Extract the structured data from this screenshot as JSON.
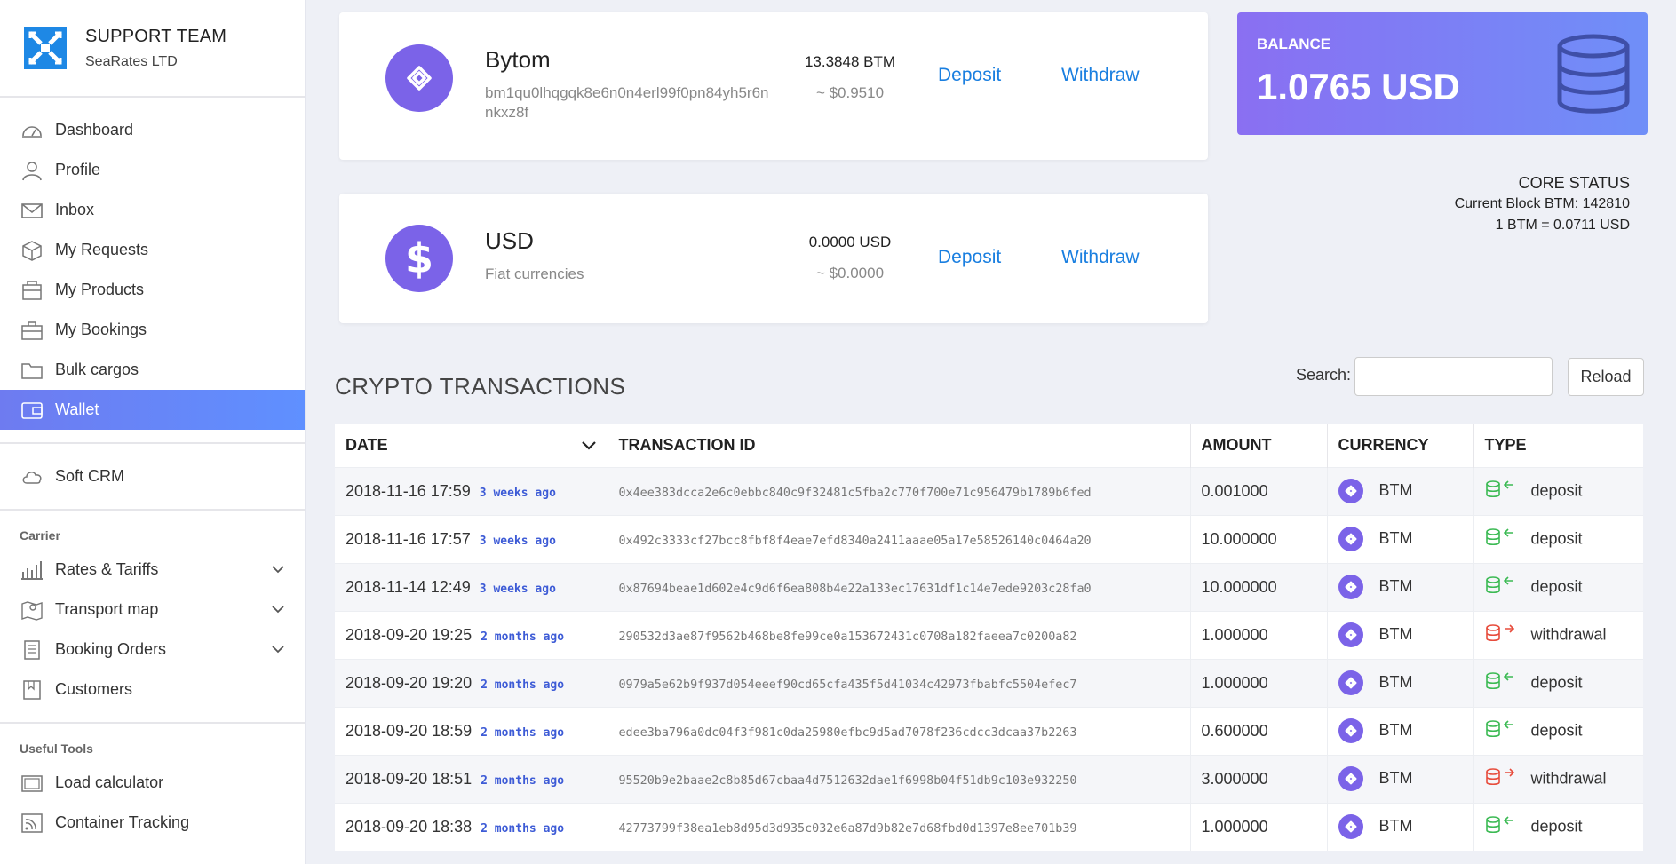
{
  "brand": {
    "title": "SUPPORT TEAM",
    "subtitle": "SeaRates LTD"
  },
  "nav": {
    "main": [
      {
        "label": "Dashboard"
      },
      {
        "label": "Profile"
      },
      {
        "label": "Inbox"
      },
      {
        "label": "My Requests"
      },
      {
        "label": "My Products"
      },
      {
        "label": "My Bookings"
      },
      {
        "label": "Bulk cargos"
      },
      {
        "label": "Wallet"
      }
    ],
    "crm": "Soft CRM",
    "carrier_section": "Carrier",
    "carrier": [
      {
        "label": "Rates & Tariffs"
      },
      {
        "label": "Transport map"
      },
      {
        "label": "Booking Orders"
      },
      {
        "label": "Customers"
      }
    ],
    "tools_section": "Useful Tools",
    "tools": [
      {
        "label": "Load calculator"
      },
      {
        "label": "Container Tracking"
      }
    ]
  },
  "wallets": [
    {
      "name": "Bytom",
      "address": "bm1qu0lhqgqk8e6n0n4erl99f0pn84yh5r6nnkxz8f",
      "amount": "13.3848 BTM",
      "usd": "~ $0.9510",
      "deposit": "Deposit",
      "withdraw": "Withdraw"
    },
    {
      "name": "USD",
      "address": "Fiat currencies",
      "amount": "0.0000 USD",
      "usd": "~ $0.0000",
      "deposit": "Deposit",
      "withdraw": "Withdraw"
    }
  ],
  "balance": {
    "label": "BALANCE",
    "value": "1.0765 USD"
  },
  "core": {
    "title": "CORE STATUS",
    "block": "Current Block BTM: 142810",
    "rate": "1 BTM = 0.0711 USD"
  },
  "transactions": {
    "title": "CRYPTO TRANSACTIONS",
    "search_label": "Search:",
    "search_value": "",
    "reload": "Reload",
    "columns": [
      "DATE",
      "TRANSACTION ID",
      "AMOUNT",
      "CURRENCY",
      "TYPE"
    ],
    "rows": [
      {
        "date": "2018-11-16 17:59",
        "ago": "3 weeks ago",
        "id": "0x4ee383dcca2e6c0ebbc840c9f32481c5fba2c770f700e71c956479b1789b6fed",
        "amount": "0.001000",
        "currency": "BTM",
        "type": "deposit"
      },
      {
        "date": "2018-11-16 17:57",
        "ago": "3 weeks ago",
        "id": "0x492c3333cf27bcc8fbf8f4eae7efd8340a2411aaae05a17e58526140c0464a20",
        "amount": "10.000000",
        "currency": "BTM",
        "type": "deposit"
      },
      {
        "date": "2018-11-14 12:49",
        "ago": "3 weeks ago",
        "id": "0x87694beae1d602e4c9d6f6ea808b4e22a133ec17631df1c14e7ede9203c28fa0",
        "amount": "10.000000",
        "currency": "BTM",
        "type": "deposit"
      },
      {
        "date": "2018-09-20 19:25",
        "ago": "2 months ago",
        "id": "290532d3ae87f9562b468be8fe99ce0a153672431c0708a182faeea7c0200a82",
        "amount": "1.000000",
        "currency": "BTM",
        "type": "withdrawal"
      },
      {
        "date": "2018-09-20 19:20",
        "ago": "2 months ago",
        "id": "0979a5e62b9f937d054eeef90cd65cfa435f5d41034c42973fbabfc5504efec7",
        "amount": "1.000000",
        "currency": "BTM",
        "type": "deposit"
      },
      {
        "date": "2018-09-20 18:59",
        "ago": "2 months ago",
        "id": "edee3ba796a0dc04f3f981c0da25980efbc9d5ad7078f236cdcc3dcaa37b2263",
        "amount": "0.600000",
        "currency": "BTM",
        "type": "deposit"
      },
      {
        "date": "2018-09-20 18:51",
        "ago": "2 months ago",
        "id": "95520b9e2baae2c8b85d67cbaa4d7512632dae1f6998b04f51db9c103e932250",
        "amount": "3.000000",
        "currency": "BTM",
        "type": "withdrawal"
      },
      {
        "date": "2018-09-20 18:38",
        "ago": "2 months ago",
        "id": "42773799f38ea1eb8d95d3d935c032e6a87d9b82e7d68fbd0d1397e8ee701b39",
        "amount": "1.000000",
        "currency": "BTM",
        "type": "deposit"
      }
    ]
  },
  "colors": {
    "accent": "#6e7bf0",
    "link": "#1a7fe0",
    "coin": "#7b63e8",
    "deposit": "#3cba54",
    "withdrawal": "#e74c3c"
  }
}
